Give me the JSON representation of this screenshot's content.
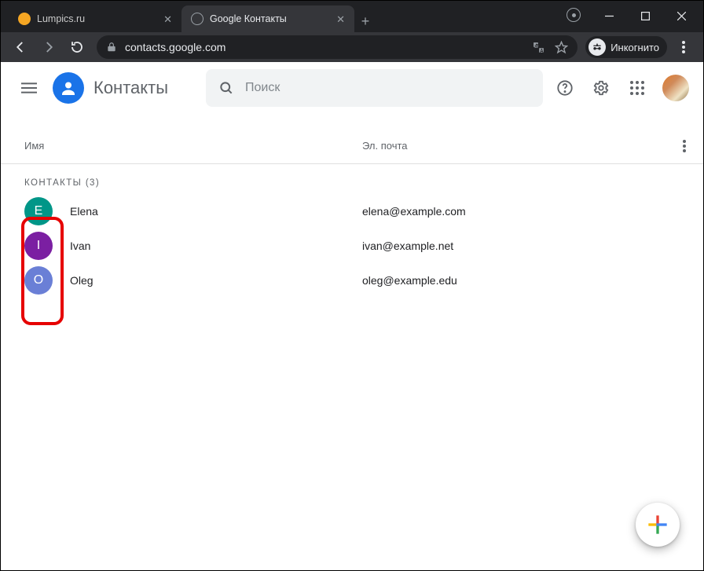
{
  "browser": {
    "tabs": [
      {
        "title": "Lumpics.ru",
        "active": false,
        "favicon_color": "#f5a623"
      },
      {
        "title": "Google Контакты",
        "active": true,
        "favicon_color": "#9aa0a6"
      }
    ],
    "url": "contacts.google.com",
    "incognito_label": "Инкогнито"
  },
  "app": {
    "title": "Контакты",
    "search_placeholder": "Поиск",
    "columns": {
      "name": "Имя",
      "email": "Эл. почта"
    },
    "section_label": "КОНТАКТЫ (3)",
    "contacts": [
      {
        "initial": "E",
        "name": "Elena",
        "email": "elena@example.com",
        "color": "#009688"
      },
      {
        "initial": "I",
        "name": "Ivan",
        "email": "ivan@example.net",
        "color": "#7b1fa2"
      },
      {
        "initial": "O",
        "name": "Oleg",
        "email": "oleg@example.edu",
        "color": "#6a7fd6"
      }
    ]
  }
}
